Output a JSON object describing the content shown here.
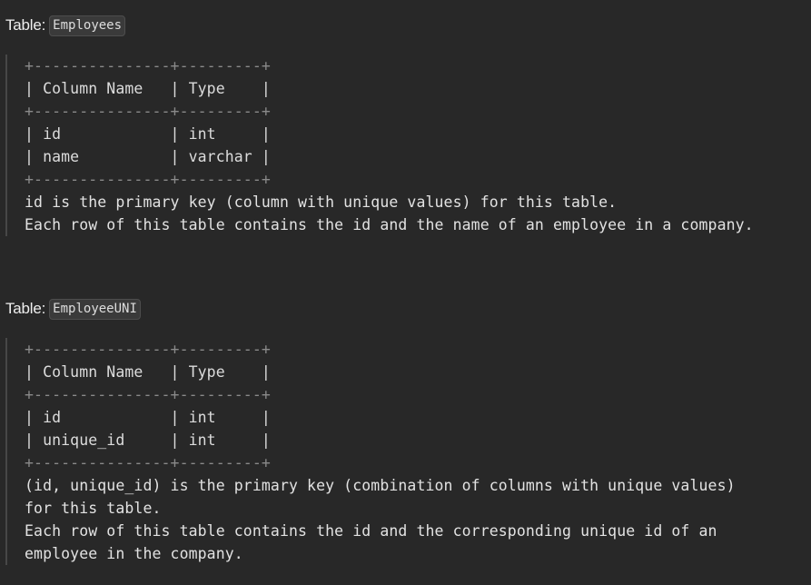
{
  "employees": {
    "label_prefix": "Table:",
    "table_name": "Employees",
    "schema_lines": [
      {
        "kind": "border",
        "text": "+---------------+---------+"
      },
      {
        "kind": "row",
        "text": "| Column Name   | Type    |"
      },
      {
        "kind": "border",
        "text": "+---------------+---------+"
      },
      {
        "kind": "row",
        "text": "| id            | int     |"
      },
      {
        "kind": "row",
        "text": "| name          | varchar |"
      },
      {
        "kind": "border",
        "text": "+---------------+---------+"
      }
    ],
    "description_lines": [
      "id is the primary key (column with unique values) for this table.",
      "Each row of this table contains the id and the name of an employee in a company."
    ]
  },
  "employee_uni": {
    "label_prefix": "Table:",
    "table_name": "EmployeeUNI",
    "schema_lines": [
      {
        "kind": "border",
        "text": "+---------------+---------+"
      },
      {
        "kind": "row",
        "text": "| Column Name   | Type    |"
      },
      {
        "kind": "border",
        "text": "+---------------+---------+"
      },
      {
        "kind": "row",
        "text": "| id            | int     |"
      },
      {
        "kind": "row",
        "text": "| unique_id     | int     |"
      },
      {
        "kind": "border",
        "text": "+---------------+---------+"
      }
    ],
    "description_lines": [
      "(id, unique_id) is the primary key (combination of columns with unique values)",
      "for this table.",
      "Each row of this table contains the id and the corresponding unique id of an",
      "employee in the company."
    ]
  }
}
